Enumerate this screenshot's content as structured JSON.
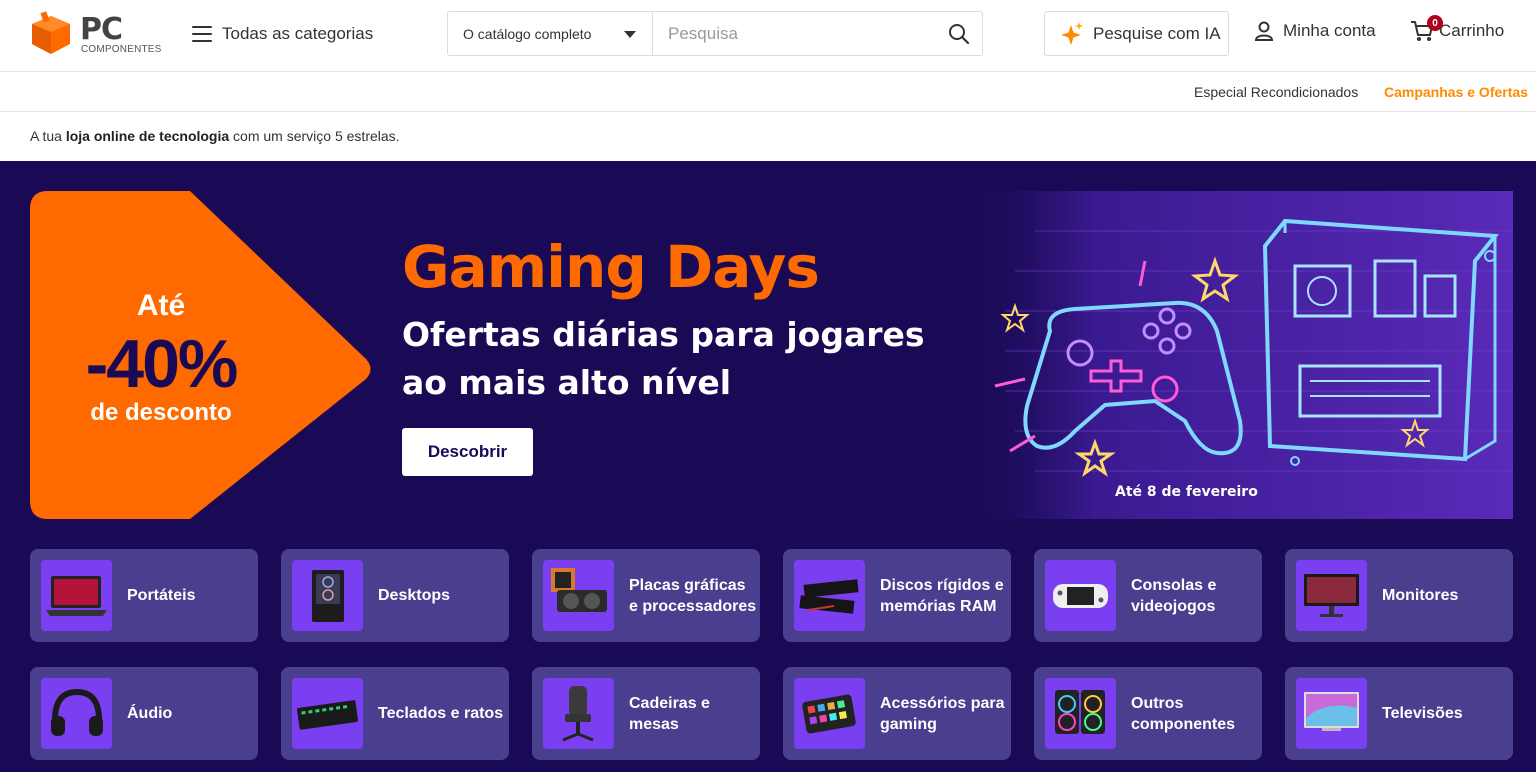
{
  "header": {
    "logo_text": "PC",
    "logo_sub": "COMPONENTES",
    "menu_label": "Todas as categorias",
    "search_scope": "O catálogo completo",
    "search_placeholder": "Pesquisa",
    "ia_label": "Pesquise com IA",
    "account_label": "Minha conta",
    "cart_label": "Carrinho",
    "cart_count": "0"
  },
  "subnav": {
    "link1": "Especial Recondicionados",
    "link2": "Campanhas e Ofertas"
  },
  "tagline": {
    "pre": "A tua ",
    "bold": "loja online de tecnologia",
    "post": " com um serviço 5 estrelas."
  },
  "banner": {
    "promo_ate": "Até",
    "promo_pct": "-40%",
    "promo_desc": "de desconto",
    "title": "Gaming Days",
    "subtitle_line1": "Ofertas diárias para jogares",
    "subtitle_line2": "ao mais alto nível",
    "cta": "Descobrir",
    "date": "Até 8 de fevereiro"
  },
  "categories": [
    {
      "label": "Portáteis",
      "icon": "laptop-icon"
    },
    {
      "label": "Desktops",
      "icon": "desktop-tower-icon"
    },
    {
      "label": "Placas gráficas e processadores",
      "icon": "gpu-icon"
    },
    {
      "label": "Discos rígidos e memórias RAM",
      "icon": "ram-icon"
    },
    {
      "label": "Consolas e videojogos",
      "icon": "handheld-console-icon"
    },
    {
      "label": "Monitores",
      "icon": "monitor-icon"
    },
    {
      "label": "Áudio",
      "icon": "headset-icon"
    },
    {
      "label": "Teclados e ratos",
      "icon": "keyboard-icon"
    },
    {
      "label": "Cadeiras e mesas",
      "icon": "gaming-chair-icon"
    },
    {
      "label": "Acessórios para gaming",
      "icon": "stream-deck-icon"
    },
    {
      "label": "Outros componentes",
      "icon": "fans-icon"
    },
    {
      "label": "Televisões",
      "icon": "tv-icon"
    }
  ],
  "colors": {
    "brand_orange": "#ff6a00",
    "background_purple": "#1a0a55",
    "tile_purple": "#4a3e8f",
    "thumb_purple": "#7b3ff2",
    "offers_link": "#ff8a00"
  }
}
